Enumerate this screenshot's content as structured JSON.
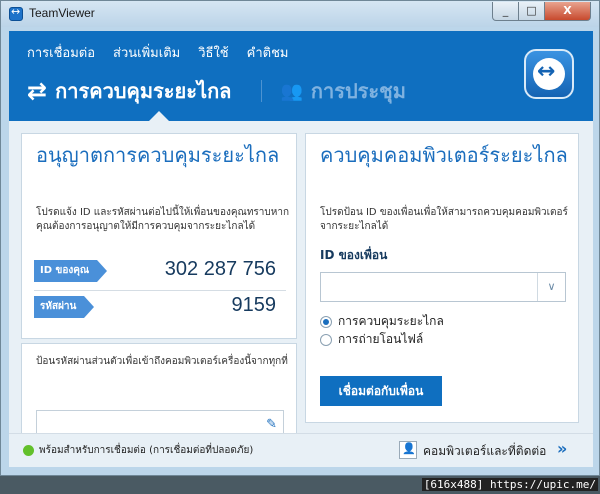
{
  "window": {
    "title": "TeamViewer",
    "close_label": "X",
    "min_label": "_",
    "max_label": "□"
  },
  "menu": [
    "การเชื่อมต่อ",
    "ส่วนเพิ่มเติม",
    "วิธีใช้",
    "คำติชม"
  ],
  "tabs": {
    "active": "การควบคุมระยะไกล",
    "inactive": "การประชุม"
  },
  "left": {
    "heading": "อนุญาตการควบคุมระยะไกล",
    "description": "โปรดแจ้ง ID และรหัสผ่านต่อไปนี้ให้เพื่อนของคุณทราบหากคุณต้องการอนุญาตให้มีการควบคุมจากระยะไกลได้",
    "id_label": "ID ของคุณ",
    "id_value": "302 287 756",
    "password_label": "รหัสผ่าน",
    "password_value": "9159",
    "personal_password_text": "ป้อนรหัสผ่านส่วนตัวเพื่อเข้าถึงคอมพิวเตอร์เครื่องนี้จากทุกที่"
  },
  "right": {
    "heading": "ควบคุมคอมพิวเตอร์ระยะไกล",
    "description": "โปรดป้อน ID ของเพื่อนเพื่อให้สามารถควบคุมคอมพิวเตอร์จากระยะไกลได้",
    "partner_label": "ID ของเพื่อน",
    "options": [
      "การควบคุมระยะไกล",
      "การถ่ายโอนไฟล์"
    ],
    "selected_option": 0,
    "connect_label": "เชื่อมต่อกับเพื่อน"
  },
  "status": {
    "text": "พร้อมสำหรับการเชื่อมต่อ (การเชื่อมต่อที่ปลอดภัย)",
    "contacts_label": "คอมพิวเตอร์และที่ติดต่อ",
    "contacts_arrow": "»",
    "dot_color": "#62c02b"
  },
  "watermark": "[616x488] https://upic.me/",
  "colors": {
    "brand": "#0f6fc0",
    "heading": "#1a6dbd"
  }
}
